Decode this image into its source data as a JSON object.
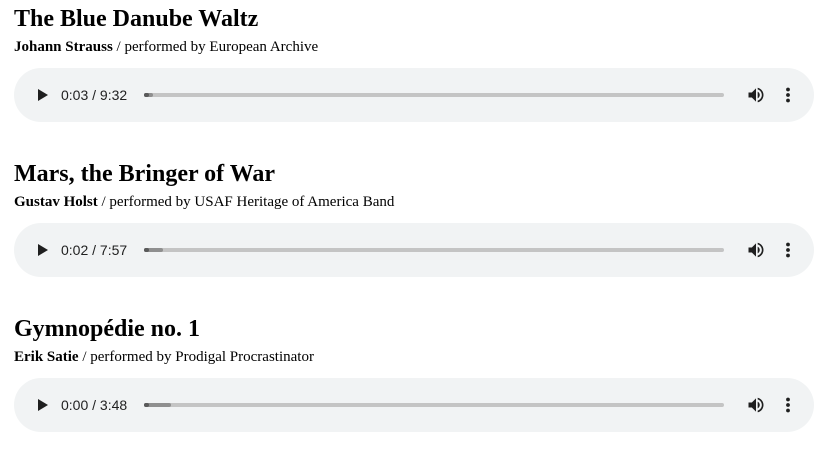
{
  "tracks": [
    {
      "title": "The Blue Danube Waltz",
      "composer": "Johann Strauss",
      "performer": "/ performed by European Archive",
      "time": "0:03 / 9:32",
      "played": 0.005,
      "buffered": 0.015
    },
    {
      "title": "Mars, the Bringer of War",
      "composer": "Gustav Holst",
      "performer": "/ performed by USAF Heritage of America Band",
      "time": "0:02 / 7:57",
      "played": 0.004,
      "buffered": 0.033
    },
    {
      "title": "Gymnopédie no. 1",
      "composer": "Erik Satie",
      "performer": "/ performed by Prodigal Procrastinator",
      "time": "0:00 / 3:48",
      "played": 0.0,
      "buffered": 0.046
    }
  ],
  "icons": {
    "play": "play-icon",
    "volume": "volume-icon",
    "menu": "more-vert-icon"
  },
  "colors": {
    "player_background": "#f1f3f4",
    "progress_track": "#c4c4c4",
    "progress_buffer": "#8f8f8f",
    "progress_played": "#5a5a5a",
    "icon": "#1f1f1f"
  }
}
